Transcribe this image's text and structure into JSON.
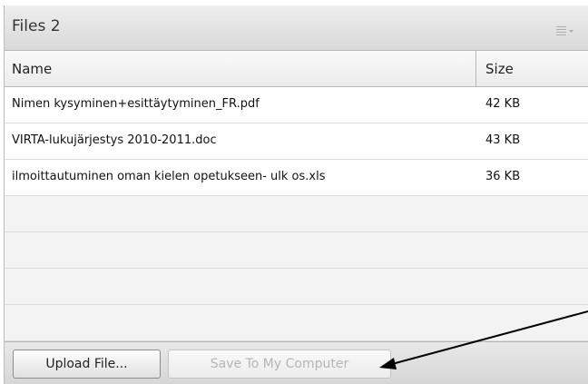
{
  "pod": {
    "title": "Files 2",
    "menu_icon": "pod-menu-icon"
  },
  "table": {
    "columns": [
      "Name",
      "Size"
    ],
    "rows": [
      {
        "name": "Nimen kysyminen+esittäytyminen_FR.pdf",
        "size": "42 KB"
      },
      {
        "name": "VIRTA-lukujärjestys 2010-2011.doc",
        "size": "43 KB"
      },
      {
        "name": "ilmoittautuminen oman kielen opetukseen- ulk os.xls",
        "size": "36 KB"
      }
    ]
  },
  "footer": {
    "upload_label": "Upload File...",
    "save_label": "Save To My Computer",
    "save_enabled": false
  },
  "annotation": {
    "type": "arrow",
    "points_to": "save-to-computer-button",
    "color": "#000000"
  }
}
